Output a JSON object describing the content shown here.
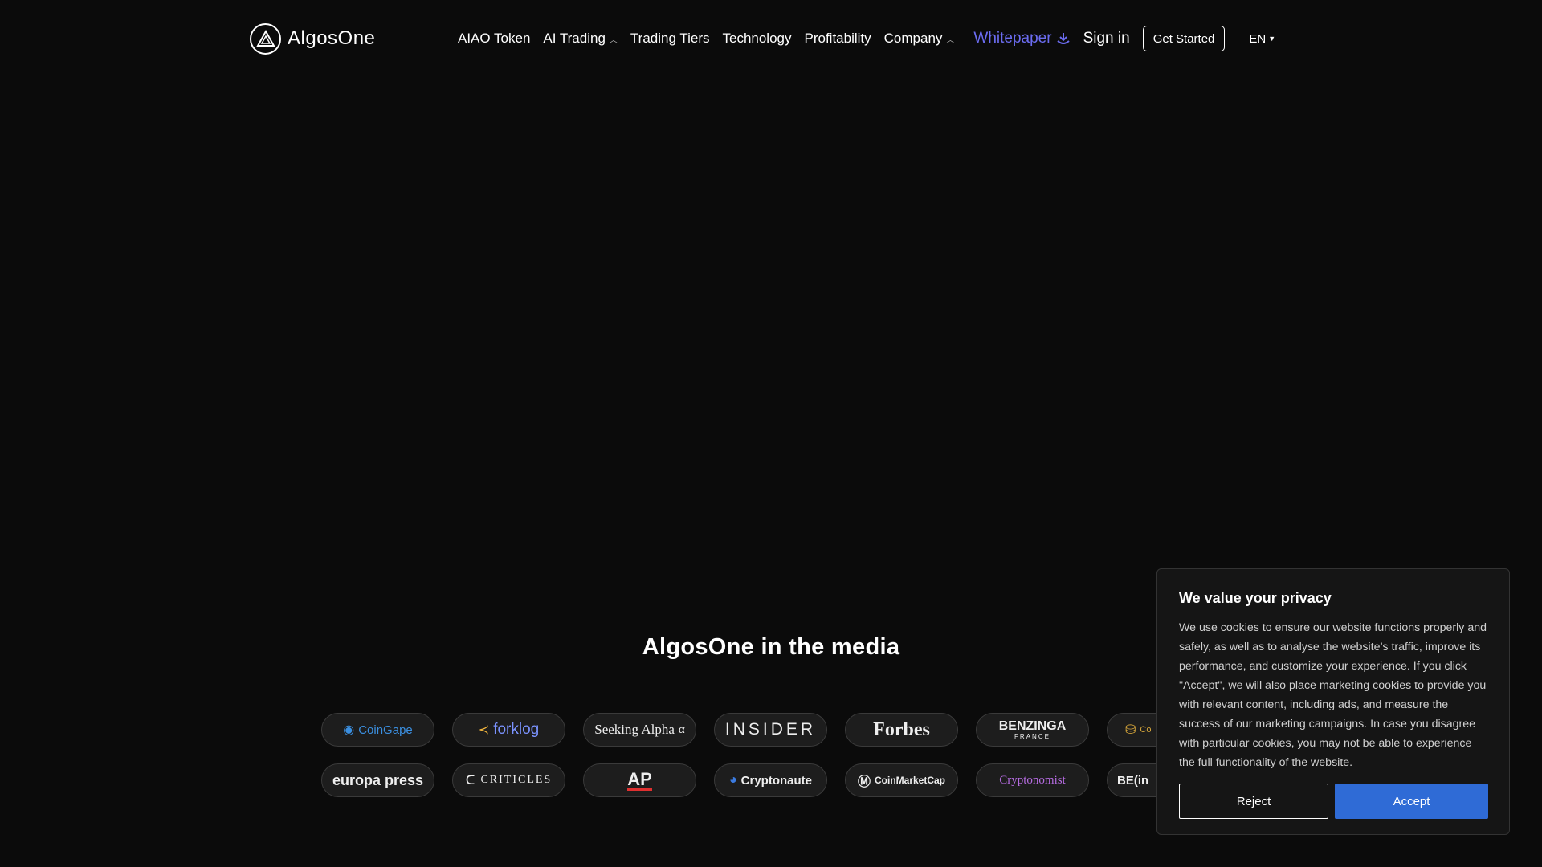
{
  "brand": {
    "name": "AlgosOne"
  },
  "nav": {
    "items": [
      {
        "label": "AIAO Token"
      },
      {
        "label": "AI Trading"
      },
      {
        "label": "Trading Tiers"
      },
      {
        "label": "Technology"
      },
      {
        "label": "Profitability"
      },
      {
        "label": "Company"
      }
    ],
    "whitepaper": "Whitepaper",
    "signin": "Sign in",
    "get_started": "Get Started",
    "language": "EN"
  },
  "media": {
    "title": "AlgosOne in the media",
    "row1": [
      "CoinGape",
      "forklog",
      "Seeking Alpha",
      "INSIDER",
      "Forbes",
      "BENZINGA",
      "Co"
    ],
    "row2": [
      "europa press",
      "CRITICLES",
      "AP",
      "Cryptonaute",
      "CoinMarketCap",
      "Cryptonomist",
      "BE(in"
    ],
    "benzinga_sub": "FRANCE"
  },
  "cookie": {
    "title": "We value your privacy",
    "body": "We use cookies to ensure our website functions properly and safely, as well as to analyse the website’s traffic, improve its performance, and customize your experience. If you click \"Accept\", we will also place marketing cookies to provide you with relevant content, including ads, and measure the success of our marketing campaigns. In case you disagree with particular cookies, you may not be able to experience the full functionality of the website.",
    "reject": "Reject",
    "accept": "Accept"
  },
  "colors": {
    "accent": "#6b6cf0",
    "accept_button": "#2f6bd6",
    "background": "#0b0b0b"
  }
}
